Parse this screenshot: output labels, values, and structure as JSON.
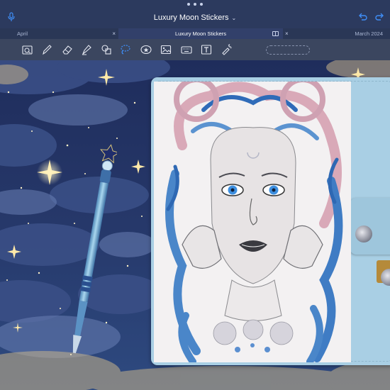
{
  "app": {
    "title": "Luxury Moon Stickers"
  },
  "tabs": [
    {
      "label": "April",
      "active": false
    },
    {
      "label": "Luxury Moon Stickers",
      "active": true
    },
    {
      "label": "March 2024",
      "active": false
    }
  ],
  "toolbar": {
    "tools": [
      {
        "name": "zoom-window-icon"
      },
      {
        "name": "pen-icon"
      },
      {
        "name": "eraser-icon"
      },
      {
        "name": "highlighter-icon"
      },
      {
        "name": "shapes-icon"
      },
      {
        "name": "lasso-icon",
        "selected": true
      },
      {
        "name": "sticker-icon"
      },
      {
        "name": "image-icon"
      },
      {
        "name": "keyboard-icon"
      },
      {
        "name": "text-icon"
      },
      {
        "name": "laser-pointer-icon"
      }
    ]
  },
  "colors": {
    "titlebar": "#2c3a5e",
    "toolbar": "#3b465f",
    "accent": "#3f8ef7",
    "planner": "#a9cfe4"
  }
}
